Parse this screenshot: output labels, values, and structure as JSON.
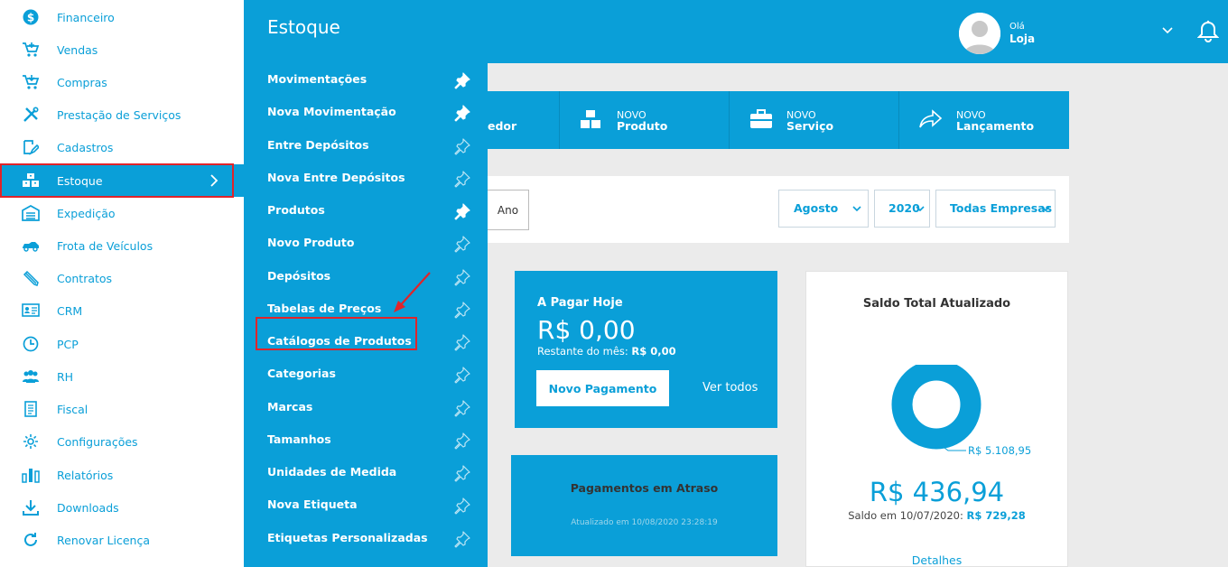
{
  "sidebar": {
    "items": [
      {
        "label": "Financeiro",
        "icon": "dollar-circle-icon"
      },
      {
        "label": "Vendas",
        "icon": "cart-icon"
      },
      {
        "label": "Compras",
        "icon": "cart-icon"
      },
      {
        "label": "Prestação de Serviços",
        "icon": "tools-icon"
      },
      {
        "label": "Cadastros",
        "icon": "edit-icon"
      },
      {
        "label": "Estoque",
        "icon": "boxes-icon",
        "active": true
      },
      {
        "label": "Expedição",
        "icon": "warehouse-icon"
      },
      {
        "label": "Frota de Veículos",
        "icon": "car-icon"
      },
      {
        "label": "Contratos",
        "icon": "pencil-icon"
      },
      {
        "label": "CRM",
        "icon": "id-card-icon"
      },
      {
        "label": "PCP",
        "icon": "clock-icon"
      },
      {
        "label": "RH",
        "icon": "people-icon"
      },
      {
        "label": "Fiscal",
        "icon": "document-icon"
      },
      {
        "label": "Configurações",
        "icon": "gear-icon"
      },
      {
        "label": "Relatórios",
        "icon": "bar-chart-icon"
      },
      {
        "label": "Downloads",
        "icon": "download-icon"
      },
      {
        "label": "Renovar Licença",
        "icon": "refresh-icon"
      }
    ]
  },
  "header": {
    "title": "Estoque",
    "greeting": "Olá",
    "user": "Loja"
  },
  "submenu": {
    "items": [
      {
        "label": "Movimentações",
        "pinned": true
      },
      {
        "label": "Nova Movimentação",
        "pinned": true
      },
      {
        "label": "Entre Depósitos",
        "pinned": false
      },
      {
        "label": "Nova Entre Depósitos",
        "pinned": false
      },
      {
        "label": "Produtos",
        "pinned": true
      },
      {
        "label": "Novo Produto",
        "pinned": false
      },
      {
        "label": "Depósitos",
        "pinned": false
      },
      {
        "label": "Tabelas de Preços",
        "pinned": false
      },
      {
        "label": "Catálogos de Produtos",
        "pinned": false
      },
      {
        "label": "Categorias",
        "pinned": false
      },
      {
        "label": "Marcas",
        "pinned": false
      },
      {
        "label": "Tamanhos",
        "pinned": false
      },
      {
        "label": "Unidades de Medida",
        "pinned": false
      },
      {
        "label": "Nova Etiqueta",
        "pinned": false
      },
      {
        "label": "Etiquetas Personalizadas",
        "pinned": false
      }
    ]
  },
  "quick_actions": {
    "partial_label": "edor",
    "product": {
      "top": "NOVO",
      "bottom": "Produto"
    },
    "service": {
      "top": "NOVO",
      "bottom": "Serviço"
    },
    "launch": {
      "top": "NOVO",
      "bottom": "Lançamento"
    }
  },
  "filters": {
    "year_button": "Ano",
    "month": "Agosto",
    "year": "2020",
    "company": "Todas Empresas"
  },
  "pay_today": {
    "title": "A Pagar Hoje",
    "amount": "R$ 0,00",
    "remaining_label": "Restante do mês: ",
    "remaining_value": "R$ 0,00",
    "new_button": "Novo Pagamento",
    "view_all": "Ver todos"
  },
  "late_payments": {
    "title": "Pagamentos em Atraso",
    "updated": "Atualizado em 10/08/2020 23:28:19"
  },
  "balance": {
    "title": "Saldo Total Atualizado",
    "donut_label": "R$ 5.108,95",
    "amount": "R$ 436,94",
    "date_label": "Saldo em 10/07/2020: ",
    "date_value": "R$ 729,28",
    "details": "Detalhes"
  },
  "colors": {
    "accent": "#0a9fd8",
    "highlight": "#e0242a"
  }
}
